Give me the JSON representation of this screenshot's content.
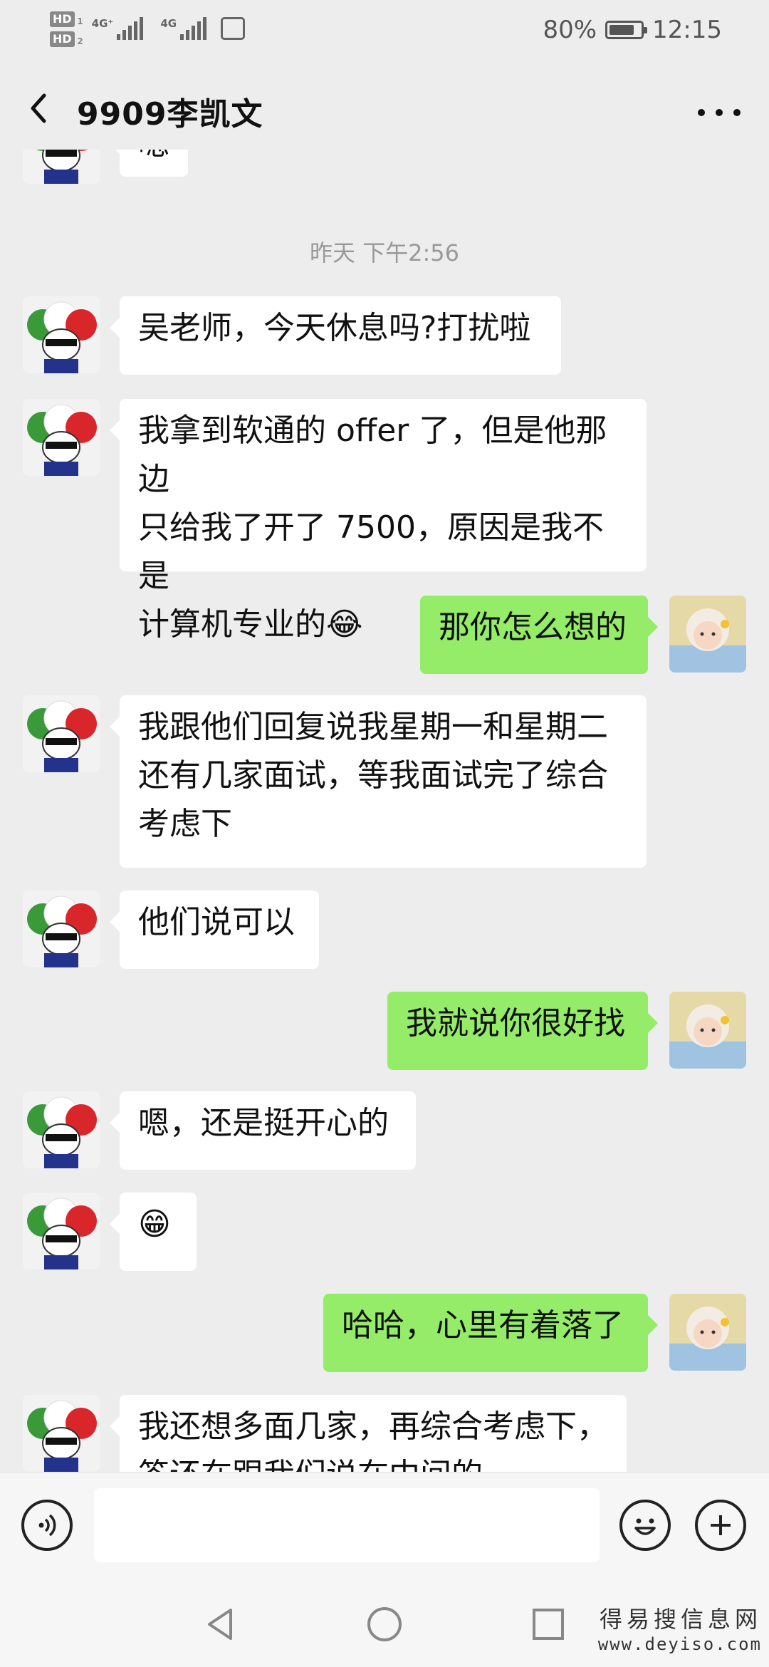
{
  "status_bar": {
    "hd1": "HD",
    "hd1_sub": "1",
    "hd2": "HD",
    "hd2_sub": "2",
    "net1": "4G⁺",
    "net2": "4G",
    "battery_percent": "80%",
    "battery_level": 0.8,
    "time": "12:15"
  },
  "nav": {
    "title": "9909李凯文",
    "back_icon": "chevron-left-icon",
    "more_icon": "more-dots-icon"
  },
  "chat": {
    "partial_top_text": "嗯",
    "timestamp": "昨天 下午2:56",
    "messages": [
      {
        "from": "other",
        "text": "吴老师，今天休息吗?打扰啦"
      },
      {
        "from": "other",
        "text": "我拿到软通的 offer 了，但是他那边\n只给我了开了 7500，原因是我不是\n计算机专业的😂"
      },
      {
        "from": "me",
        "text": "那你怎么想的"
      },
      {
        "from": "other",
        "text": "我跟他们回复说我星期一和星期二\n还有几家面试，等我面试完了综合\n考虑下"
      },
      {
        "from": "other",
        "text": "他们说可以"
      },
      {
        "from": "me",
        "text": "我就说你很好找"
      },
      {
        "from": "other",
        "text": "嗯，还是挺开心的"
      },
      {
        "from": "other",
        "text": "😁"
      },
      {
        "from": "me",
        "text": "哈哈，心里有着落了"
      },
      {
        "from": "other",
        "text": "我还想多面几家，再综合考虑下，\n答还在跟我们说在中间的"
      }
    ]
  },
  "input_bar": {
    "voice_icon": "voice-icon",
    "emoji_icon": "emoji-icon",
    "add_icon": "plus-icon"
  },
  "system_nav": {
    "back_icon": "triangle-back-icon",
    "home_icon": "circle-home-icon",
    "recents_icon": "square-recents-icon"
  },
  "watermark": {
    "line1": "得易搜信息网",
    "line2": "www.deyiso.com"
  }
}
